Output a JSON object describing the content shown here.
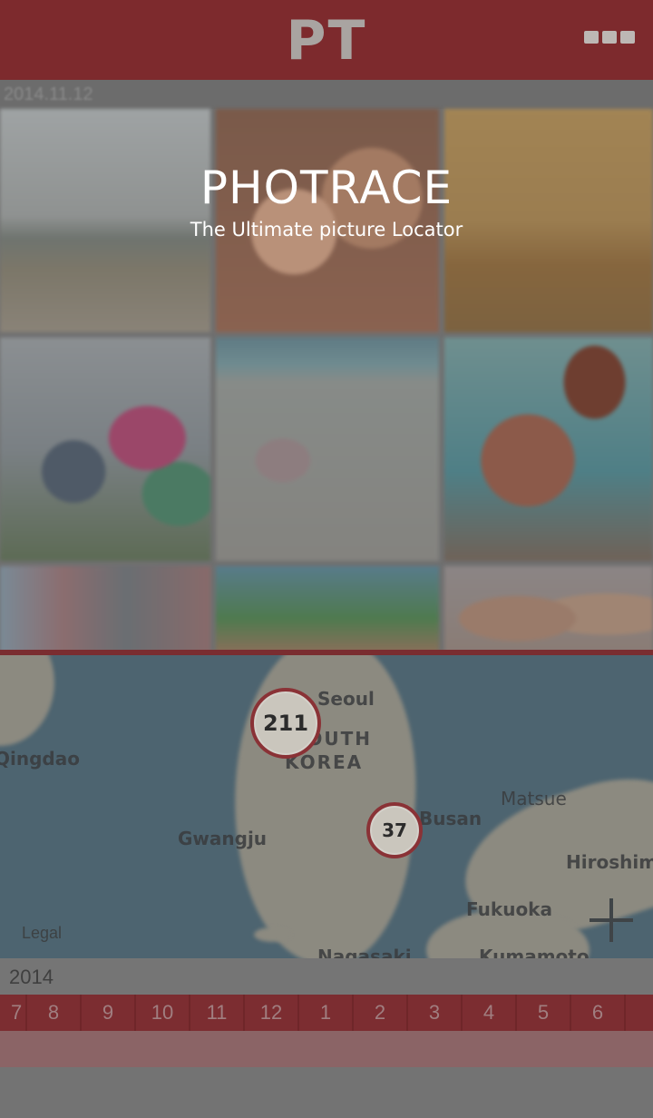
{
  "header": {
    "logo": "PT",
    "menu_icon": "more-icon"
  },
  "date_header": "2014.11.12",
  "hero": {
    "title": "PHOTRACE",
    "subtitle": "The Ultimate picture Locator"
  },
  "map": {
    "labels": [
      "Seoul",
      "SOUTH",
      "KOREA",
      "Gwangju",
      "Busan",
      "Matsue",
      "Hiroshima",
      "Fukuoka",
      "Nagasaki",
      "Kumamoto",
      "Qingdao"
    ],
    "clusters": [
      {
        "count": "211"
      },
      {
        "count": "37"
      }
    ],
    "legal": "Legal",
    "zoom_icon": "plus-icon"
  },
  "timeline": {
    "year": "2014",
    "months": [
      "7",
      "8",
      "9",
      "10",
      "11",
      "12",
      "1",
      "2",
      "3",
      "4",
      "5",
      "6"
    ]
  },
  "colors": {
    "header": "#7d2a2d",
    "accent": "#8a3236"
  }
}
